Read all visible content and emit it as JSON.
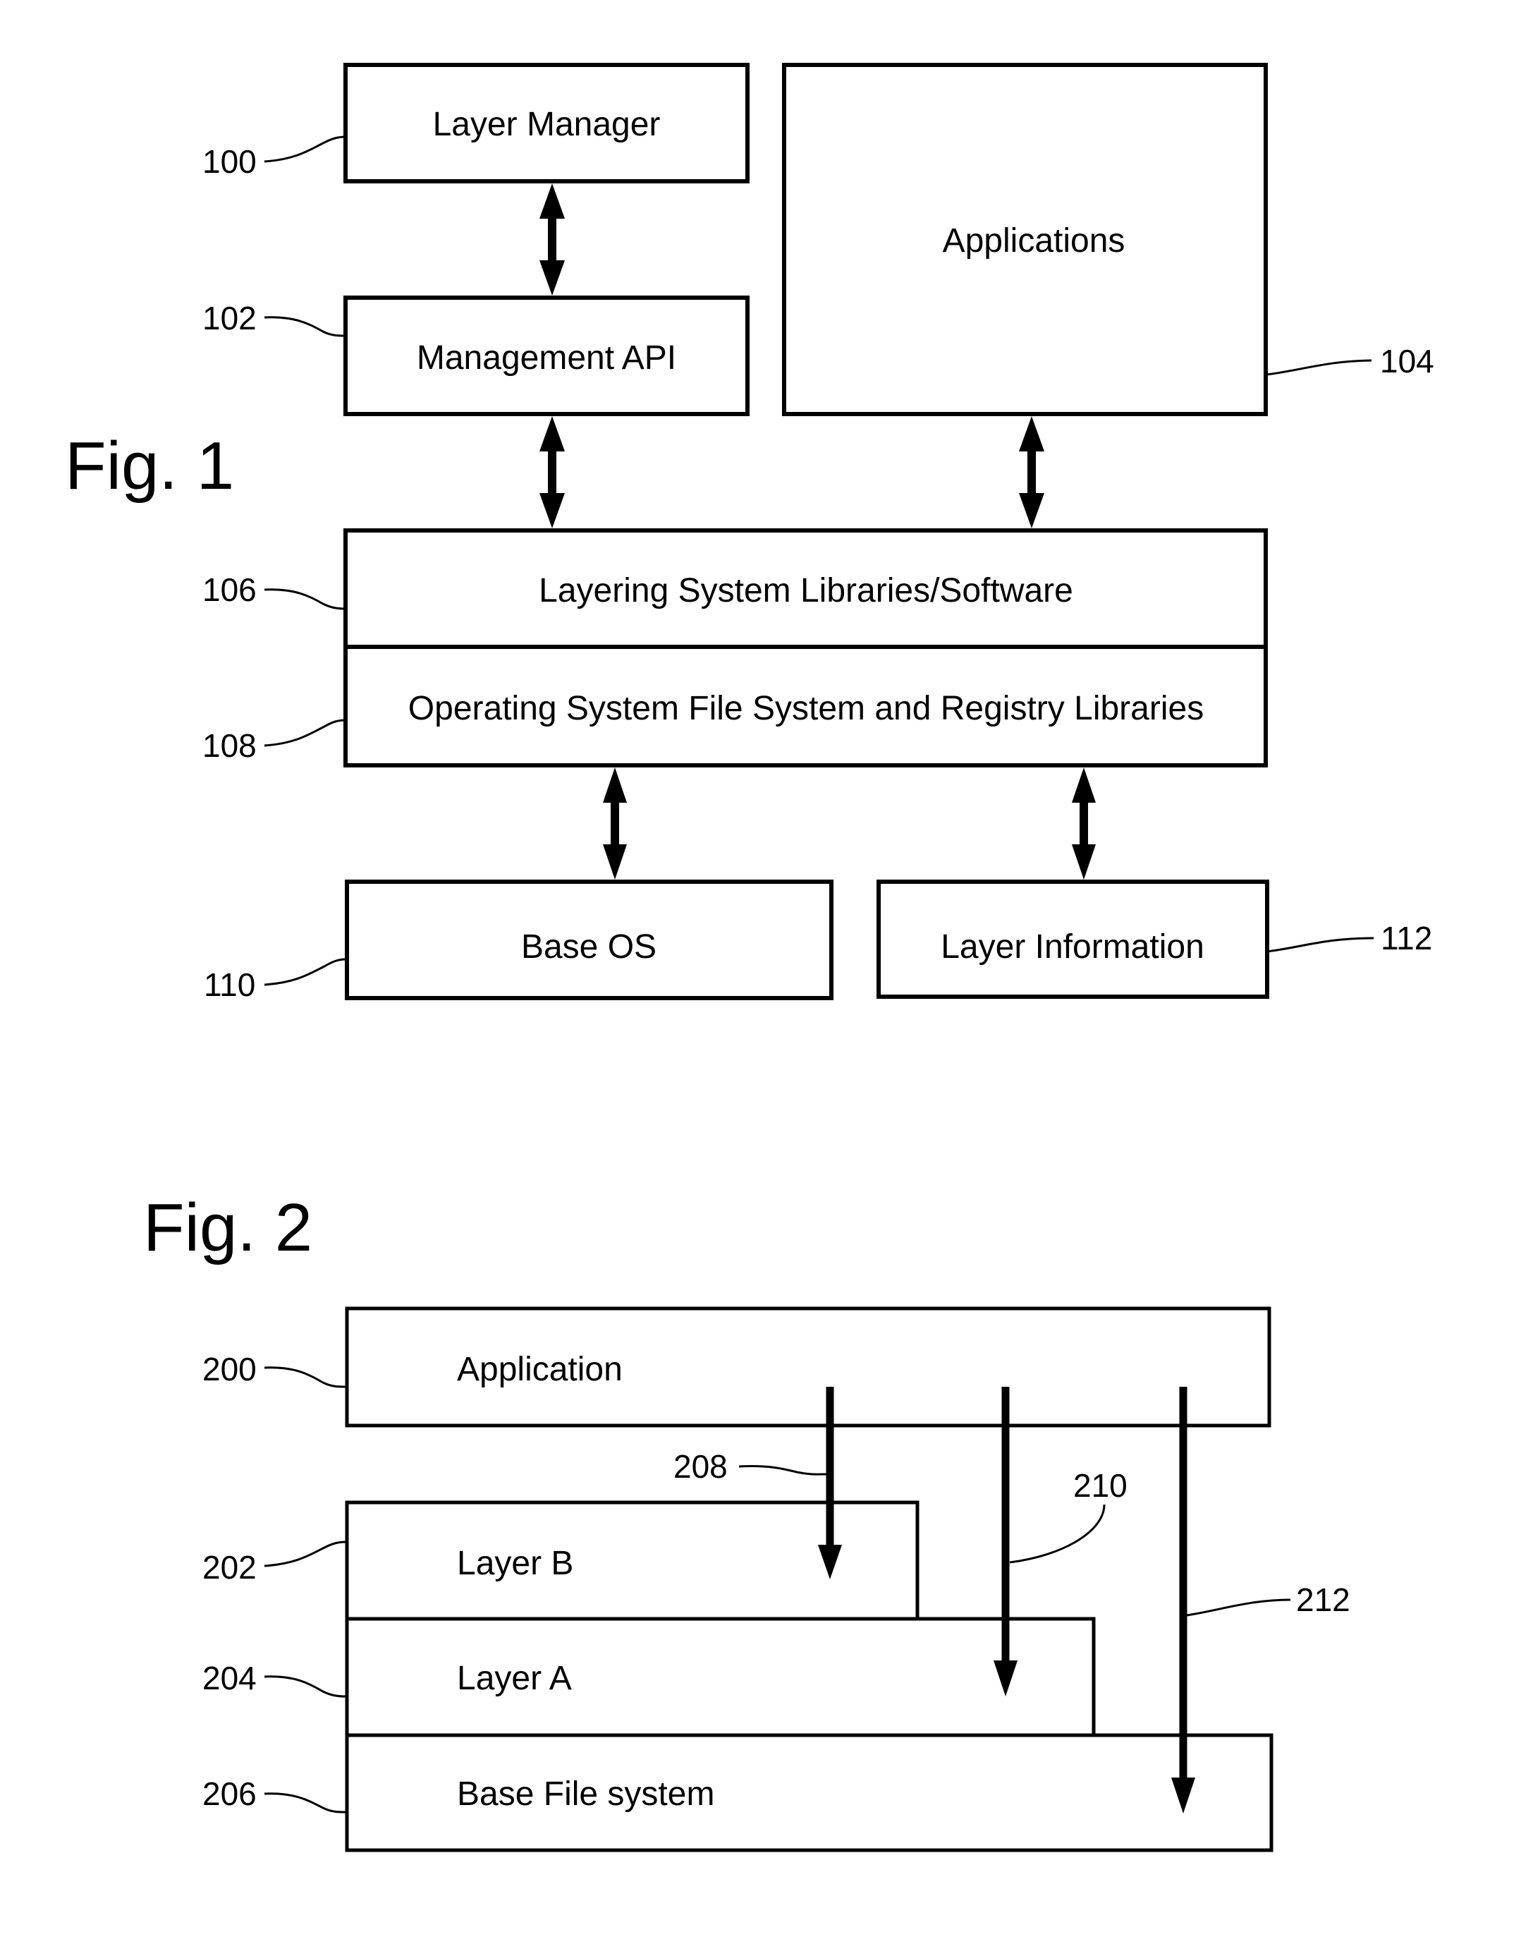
{
  "figure1": {
    "title": "Fig. 1",
    "components": [
      {
        "ref": "100",
        "label": "Layer Manager"
      },
      {
        "ref": "102",
        "label": "Management API"
      },
      {
        "ref": "104",
        "label": "Applications"
      },
      {
        "ref": "106",
        "label": "Layering System Libraries/Software"
      },
      {
        "ref": "108",
        "label": "Operating System File System and Registry Libraries"
      },
      {
        "ref": "110",
        "label": "Base OS"
      },
      {
        "ref": "112",
        "label": "Layer Information"
      }
    ],
    "connections": [
      {
        "from": "Layer Manager",
        "to": "Management API",
        "type": "bidirectional"
      },
      {
        "from": "Management API",
        "to": "Layering System Libraries/Software",
        "type": "bidirectional"
      },
      {
        "from": "Applications",
        "to": "Layering System Libraries/Software",
        "type": "bidirectional"
      },
      {
        "from": "Operating System File System and Registry Libraries",
        "to": "Base OS",
        "type": "bidirectional"
      },
      {
        "from": "Operating System File System and Registry Libraries",
        "to": "Layer Information",
        "type": "bidirectional"
      }
    ]
  },
  "figure2": {
    "title": "Fig. 2",
    "components": [
      {
        "ref": "200",
        "label": "Application"
      },
      {
        "ref": "202",
        "label": "Layer B"
      },
      {
        "ref": "204",
        "label": "Layer A"
      },
      {
        "ref": "206",
        "label": "Base File system"
      }
    ],
    "arrows": [
      {
        "ref": "208",
        "from": "Application",
        "to": "Layer B"
      },
      {
        "ref": "210",
        "from": "Application",
        "to": "Layer A"
      },
      {
        "ref": "212",
        "from": "Application",
        "to": "Base File system"
      }
    ]
  }
}
